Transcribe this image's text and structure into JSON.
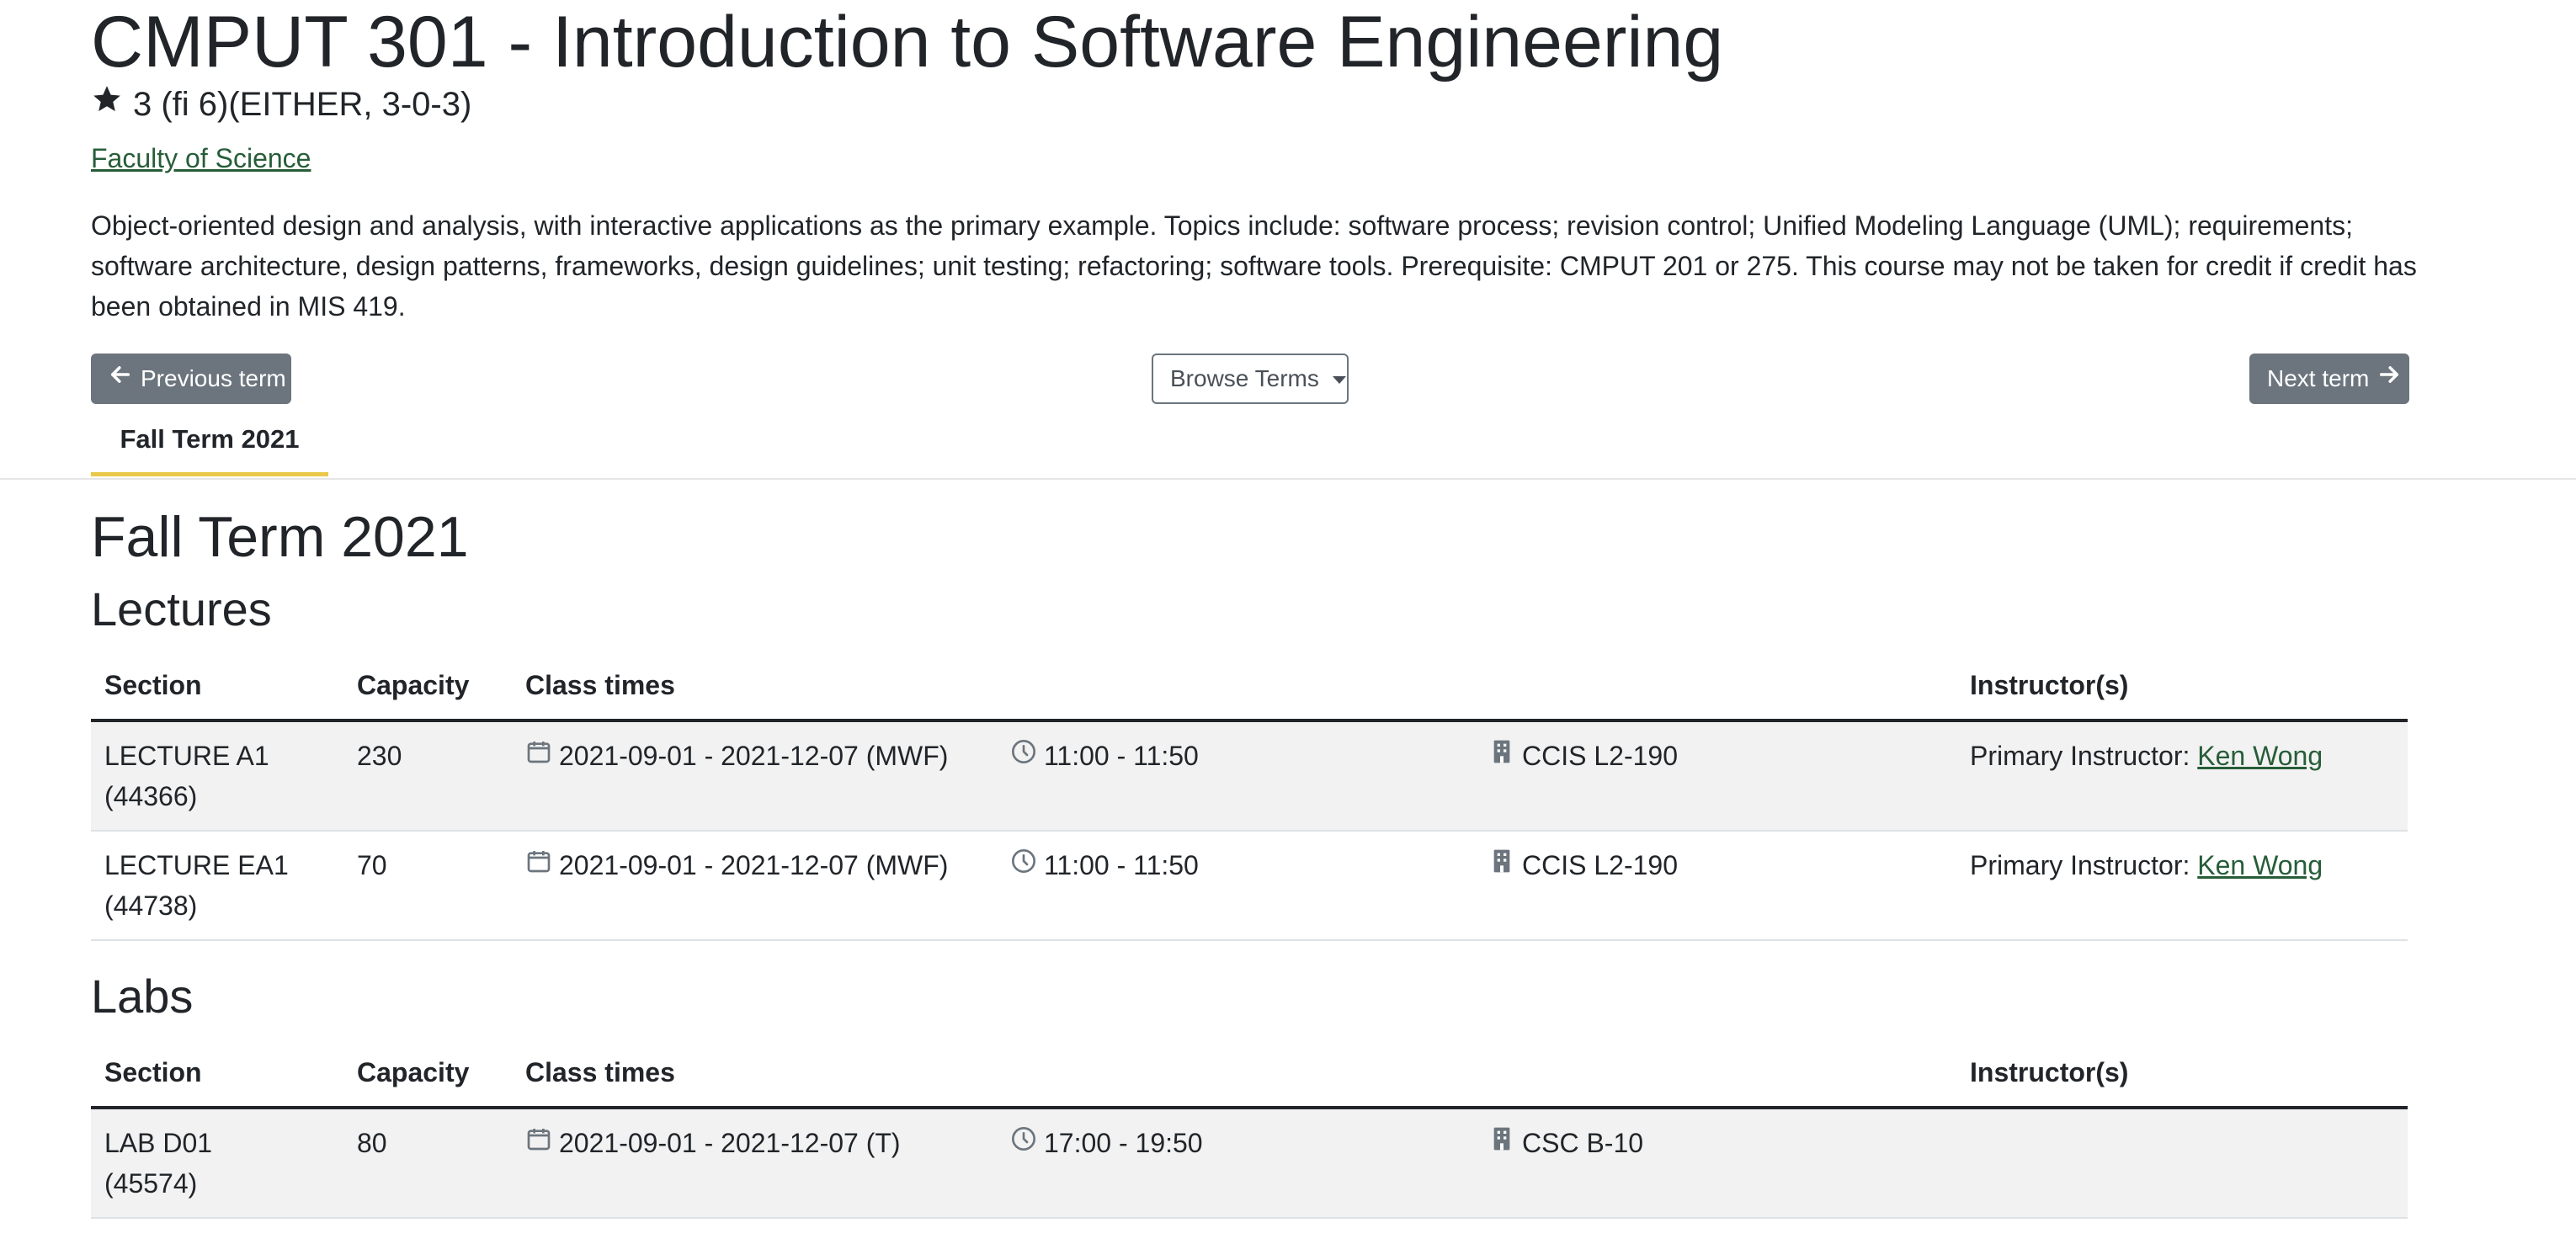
{
  "course": {
    "title": "CMPUT 301 - Introduction to Software Engineering",
    "units": "3 (fi 6)(EITHER, 3-0-3)",
    "faculty": "Faculty of Science",
    "description": "Object-oriented design and analysis, with interactive applications as the primary example. Topics include: software process; revision control; Unified Modeling Language (UML); requirements; software architecture, design patterns, frameworks, design guidelines; unit testing; refactoring; software tools. Prerequisite: CMPUT 201 or 275. This course may not be taken for credit if credit has been obtained in MIS 419."
  },
  "nav": {
    "prev_label": "Previous term",
    "browse_label": "Browse Terms",
    "next_label": "Next term"
  },
  "tabs": [
    {
      "label": "Fall Term 2021"
    }
  ],
  "term": {
    "heading": "Fall Term 2021",
    "lectures_heading": "Lectures",
    "labs_heading": "Labs",
    "columns": {
      "section": "Section",
      "capacity": "Capacity",
      "class_times": "Class times",
      "instructors": "Instructor(s)"
    },
    "lectures": [
      {
        "section": "LECTURE A1",
        "id": "(44366)",
        "capacity": "230",
        "dates": "2021-09-01 - 2021-12-07 (MWF)",
        "time": "11:00 - 11:50",
        "room": "CCIS L2-190",
        "instructor_prefix": "Primary Instructor:",
        "instructor_name": "Ken Wong"
      },
      {
        "section": "LECTURE EA1",
        "id": "(44738)",
        "capacity": "70",
        "dates": "2021-09-01 - 2021-12-07 (MWF)",
        "time": "11:00 - 11:50",
        "room": "CCIS L2-190",
        "instructor_prefix": "Primary Instructor:",
        "instructor_name": "Ken Wong"
      }
    ],
    "labs": [
      {
        "section": "LAB D01",
        "id": "(45574)",
        "capacity": "80",
        "dates": "2021-09-01 - 2021-12-07 (T)",
        "time": "17:00 - 19:50",
        "room": "CSC B-10"
      }
    ]
  },
  "colors": {
    "link": "#275d38",
    "tab_underline": "#e8c94a",
    "button_secondary": "#6c757d"
  },
  "icons": [
    "star-icon",
    "arrow-left-icon",
    "arrow-right-icon",
    "calendar-icon",
    "clock-icon",
    "building-icon"
  ]
}
